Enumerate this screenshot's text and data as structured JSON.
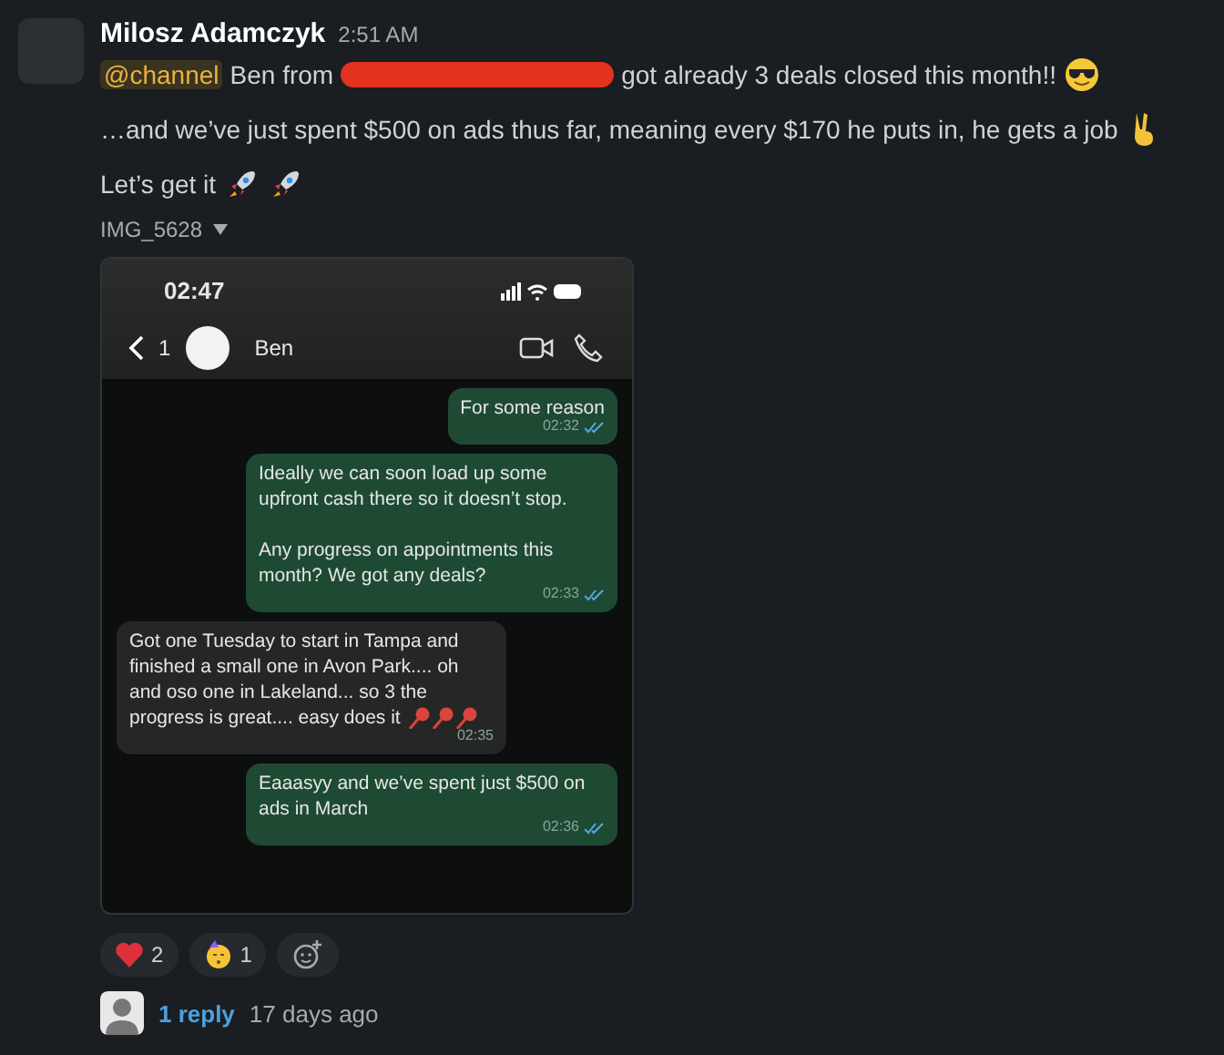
{
  "message": {
    "author": "Milosz Adamczyk",
    "time": "2:51 AM",
    "line1": {
      "mention": "@channel",
      "before": "Ben from",
      "after": "got already 3 deals closed this month!!"
    },
    "line2": "…and we’ve just spent $500 on ads thus far, meaning every $170 he puts in, he gets a job",
    "line3": "Let’s get it",
    "attachment": {
      "name": "IMG_5628"
    }
  },
  "phone": {
    "clock": "02:47",
    "back_count": "1",
    "contact": "Ben",
    "messages": [
      {
        "kind": "outgoing",
        "text": "For some reason",
        "time": "02:32",
        "read": true
      },
      {
        "kind": "outgoing",
        "text": "Ideally we can soon load up some upfront cash there so it doesn’t stop.\n\nAny progress on appointments this month? We got any deals?",
        "time": "02:33",
        "read": true
      },
      {
        "kind": "incoming",
        "text": "Got one Tuesday to start in Tampa and finished a small one in  Avon Park.... oh and oso one in Lakeland... so 3 the progress is great.... easy does it",
        "time": "02:35",
        "pins": true
      },
      {
        "kind": "outgoing",
        "text": "Eaaasyy and we’ve spent just $500 on ads in March",
        "time": "02:36",
        "read": true
      }
    ]
  },
  "reactions": [
    {
      "kind": "heart",
      "count": "2"
    },
    {
      "kind": "party",
      "count": "1"
    }
  ],
  "thread": {
    "replies": "1 reply",
    "when": "17 days ago"
  }
}
